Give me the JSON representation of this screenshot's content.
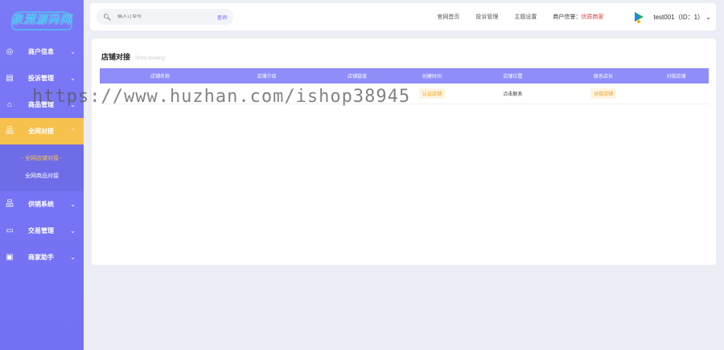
{
  "brand": {
    "logo_text": "泉溯源码网"
  },
  "sidebar": {
    "items": [
      {
        "label": "商户信息",
        "icon": "user-circle-icon"
      },
      {
        "label": "投诉管理",
        "icon": "clipboard-icon"
      },
      {
        "label": "商品管理",
        "icon": "bag-icon"
      },
      {
        "label": "全网对接",
        "icon": "sitemap-icon",
        "active": true
      },
      {
        "label": "供销系统",
        "icon": "sitemap-icon"
      },
      {
        "label": "交易管理",
        "icon": "calendar-icon"
      },
      {
        "label": "商家助手",
        "icon": "ticket-icon"
      }
    ],
    "submenu": [
      {
        "label": "- 全网店铺对接 -",
        "active": true
      },
      {
        "label": "全网商品对接"
      }
    ]
  },
  "header": {
    "search_placeholder": "输入订单号",
    "search_button": "查询",
    "links": [
      "官网首页",
      "投诉管理",
      "主题设置"
    ],
    "credit_label": "商户信誉：",
    "credit_value": "优质商家",
    "user": "test001（ID：1）",
    "user_chevron": "⌄"
  },
  "card": {
    "title": "店铺对接",
    "subtitle": "Store docking",
    "columns": [
      "店铺名称",
      "店铺介绍",
      "店铺链接",
      "创建时间",
      "店铺位置",
      "联系店长",
      "对接店铺"
    ],
    "rows": [
      {
        "name": "",
        "intro": "—",
        "link": "",
        "created": "认证店铺",
        "location": "点击联系",
        "contact": "对接店铺",
        "dock": ""
      }
    ]
  },
  "watermark": "https://www.huzhan.com/ishop38945",
  "colors": {
    "sidebar": "#7b79f6",
    "active": "#f7c14e",
    "table_head": "#8f8ef9",
    "accent": "#6c63ff",
    "danger": "#e23a3a"
  }
}
